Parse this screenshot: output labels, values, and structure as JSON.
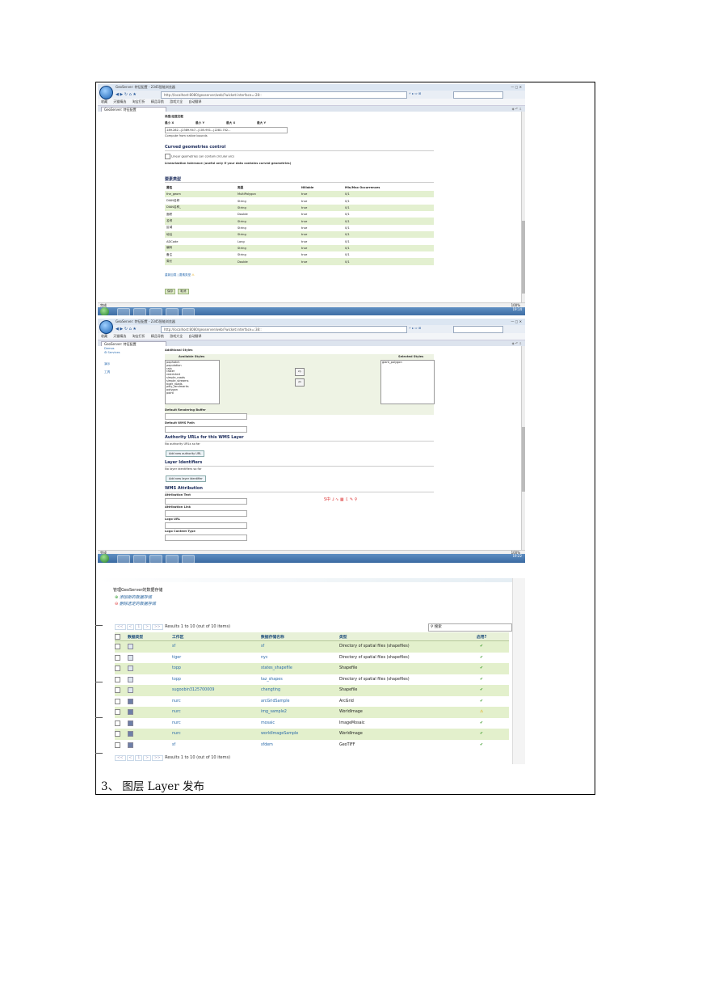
{
  "caption": "3、 图层 Layer 发布",
  "browser": {
    "title": "GeoServer: 特征配置 - 2345智能浏览器",
    "address": "http://localhost:8080/geoserver/web/?wicket:interface=:28::",
    "address2": "http://localhost:8080/geoserver/web/?wicket:interface=:38::",
    "tab_label": "GeoServer: 特征配置",
    "bookmarks": [
      "收藏",
      "天猫精选",
      "淘宝打折",
      "精品导航",
      "游戏大全",
      "自动翻译"
    ],
    "status_left": "完成",
    "status_right": "100%",
    "clock1": "19:14",
    "clock2": "19:22"
  },
  "shot1": {
    "bbox_title": "纬度/经度边框",
    "bbox_headers": [
      "最小 X",
      "最小 Y",
      "最大 X",
      "最大 Y"
    ],
    "bbox_value": "-189.282...|2389.947...|105.951...|2281.702...",
    "compute_link": "Compute from native bounds",
    "curved_title": "Curved geometries control",
    "curved_checkbox": "Linear geometries can contain circular arcs",
    "linearization": "Linearization tolerance (useful only if your data contains curved geometries)",
    "feature_type_title": "要素类型",
    "ft_headers": [
      "属性",
      "类型",
      "Nillable",
      "Min/Max Occurrences"
    ],
    "ft_rows": [
      [
        "the_geom",
        "MultiPolygon",
        "true",
        "0/1"
      ],
      [
        "DIAN名称",
        "String",
        "true",
        "0/1"
      ],
      [
        "DIAN名称_",
        "String",
        "true",
        "0/1"
      ],
      [
        "面积",
        "Double",
        "true",
        "0/1"
      ],
      [
        "名称",
        "String",
        "true",
        "0/1"
      ],
      [
        "区域",
        "String",
        "true",
        "0/1"
      ],
      [
        "地址",
        "String",
        "true",
        "0/1"
      ],
      [
        "ADCode",
        "Long",
        "true",
        "0/1"
      ],
      [
        "编码",
        "String",
        "true",
        "0/1"
      ],
      [
        "备注",
        "String",
        "true",
        "0/1"
      ],
      [
        "周长",
        "Double",
        "true",
        "0/1"
      ]
    ],
    "reload_link": "重新加载 | 要素类型",
    "save_btn": "保存",
    "cancel_btn": "取消"
  },
  "shot2": {
    "side": [
      "Demos",
      "Services",
      "演示",
      "工具"
    ],
    "additional_styles": "Additional Styles",
    "available_styles": "Available Styles",
    "selected_styles": "Selected Styles",
    "available_list": [
      "pophatch",
      "population",
      "rain",
      "raster",
      "restricted",
      "simple_roads",
      "simple_streams",
      "tiger_roads",
      "poly_landmarks",
      "polygon",
      "point"
    ],
    "selected_list": [
      "giant_polygon"
    ],
    "default_rendering_buffer": "Default Rendering Buffer",
    "default_wms_path": "Default WMS Path",
    "authority_title": "Authority URLs for this WMS Layer",
    "authority_none": "No authority URLs so far",
    "add_authority_btn": "Add new authority URL",
    "identifiers_title": "Layer Identifiers",
    "identifiers_none": "No layer identifiers so far",
    "add_identifier_btn": "Add new layer identifier",
    "attribution_title": "WMS Attribution",
    "attribution_text": "Attribution Text",
    "attribution_link": "Attribution Link",
    "logo_url": "Logo URL",
    "logo_content_type": "Logo Content Type",
    "ime_bar": "S中 ⅃ ∿ ▦ ⇩ ✎ ⚲"
  },
  "shot3": {
    "heading": "管理GeoServer的数据存储",
    "add_link": "添加新的数据存储",
    "remove_link": "删除选定的数据存储",
    "pager_text": "Results 1 to 10 (out of 10 items)",
    "pager_buttons": [
      "<<",
      "<",
      "1",
      ">",
      ">>"
    ],
    "search_placeholder": "搜索",
    "headers": [
      "数据类型",
      "工作区",
      "数据存储名称",
      "类型",
      "启用?"
    ],
    "rows": [
      {
        "ws": "sf",
        "name": "sf",
        "type": "Directory of spatial files (shapefiles)",
        "raster": false,
        "enabled": "ok"
      },
      {
        "ws": "tiger",
        "name": "nyc",
        "type": "Directory of spatial files (shapefiles)",
        "raster": false,
        "enabled": "ok"
      },
      {
        "ws": "topp",
        "name": "states_shapefile",
        "type": "Shapefile",
        "raster": false,
        "enabled": "ok"
      },
      {
        "ws": "topp",
        "name": "taz_shapes",
        "type": "Directory of spatial files (shapefiles)",
        "raster": false,
        "enabled": "ok"
      },
      {
        "ws": "sugoobin3125700009",
        "name": "chengting",
        "type": "Shapefile",
        "raster": false,
        "enabled": "ok"
      },
      {
        "ws": "nurc",
        "name": "arcGridSample",
        "type": "ArcGrid",
        "raster": true,
        "enabled": "ok"
      },
      {
        "ws": "nurc",
        "name": "img_sample2",
        "type": "WorldImage",
        "raster": true,
        "enabled": "warn"
      },
      {
        "ws": "nurc",
        "name": "mosaic",
        "type": "ImageMosaic",
        "raster": true,
        "enabled": "ok"
      },
      {
        "ws": "nurc",
        "name": "worldImageSample",
        "type": "WorldImage",
        "raster": true,
        "enabled": "ok"
      },
      {
        "ws": "sf",
        "name": "sfdem",
        "type": "GeoTIFF",
        "raster": true,
        "enabled": "ok"
      }
    ],
    "check_glyph": "✔",
    "warn_glyph": "⚠"
  }
}
